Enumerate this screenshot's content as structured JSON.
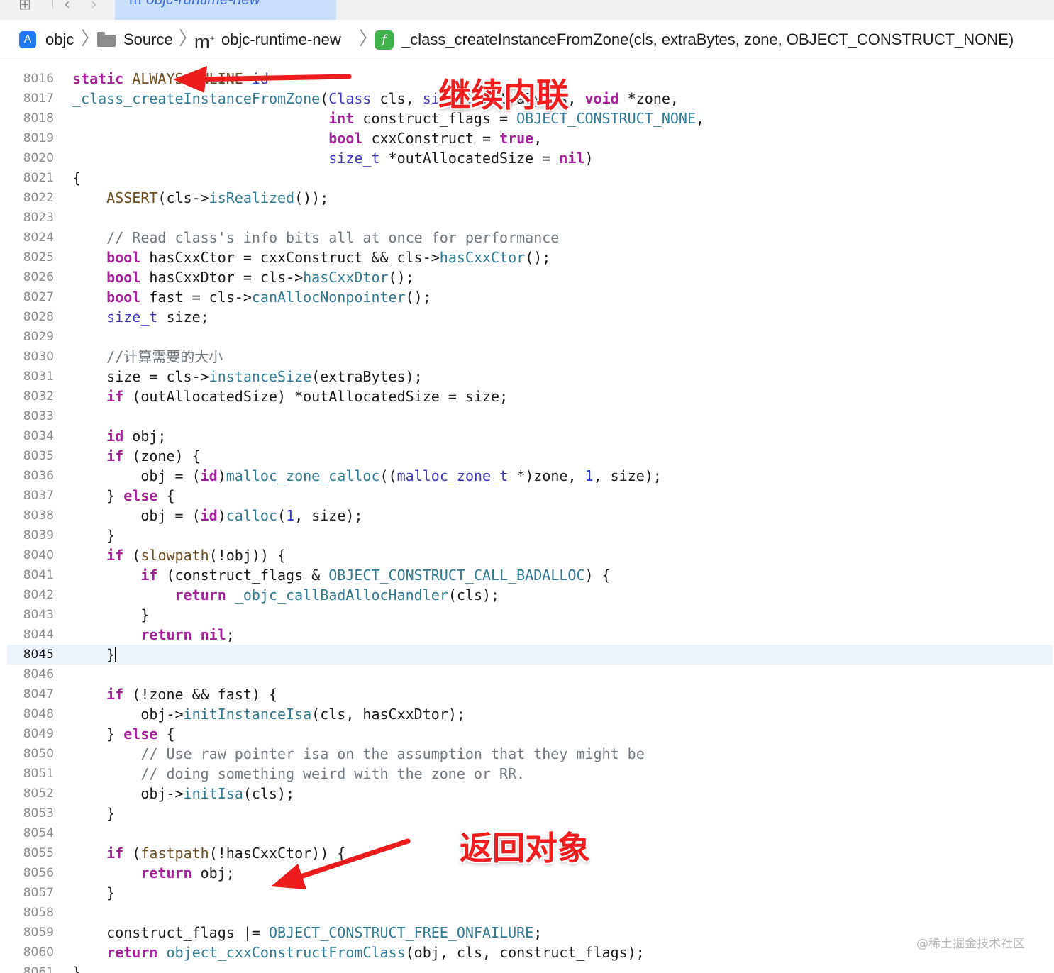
{
  "tab": {
    "label": "objc-runtime-new",
    "icon": "m"
  },
  "breadcrumb": {
    "items": [
      {
        "label": "objc"
      },
      {
        "label": "Source"
      },
      {
        "label": "objc-runtime-new"
      },
      {
        "label": "_class_createInstanceFromZone(cls, extraBytes, zone, OBJECT_CONSTRUCT_NONE)"
      }
    ]
  },
  "editor": {
    "current_line": "8045",
    "lines": [
      {
        "n": "8016",
        "html": "<span class=\"kw\">static</span> <span class=\"mc\">ALWAYS_INLINE</span> <span class=\"ty\">id</span>"
      },
      {
        "n": "8017",
        "html": "<span class=\"fn\">_class_createInstanceFromZone</span>(<span class=\"ty\">Class</span> cls, <span class=\"ty\">size_t</span> extraBytes, <span class=\"kw\">void</span> *zone,"
      },
      {
        "n": "8018",
        "html": "                              <span class=\"kw\">int</span> construct_flags = <span class=\"fn\">OBJECT_CONSTRUCT_NONE</span>,"
      },
      {
        "n": "8019",
        "html": "                              <span class=\"kw\">bool</span> cxxConstruct = <span class=\"kw\">true</span>,"
      },
      {
        "n": "8020",
        "html": "                              <span class=\"ty\">size_t</span> *outAllocatedSize = <span class=\"kw\">nil</span>)"
      },
      {
        "n": "8021",
        "html": "{"
      },
      {
        "n": "8022",
        "html": "    <span class=\"mc\">ASSERT</span>(cls-&gt;<span class=\"fn\">isRealized</span>());"
      },
      {
        "n": "8023",
        "html": ""
      },
      {
        "n": "8024",
        "html": "    <span class=\"cm\">// Read class's info bits all at once for performance</span>"
      },
      {
        "n": "8025",
        "html": "    <span class=\"kw\">bool</span> hasCxxCtor = cxxConstruct &amp;&amp; cls-&gt;<span class=\"fn\">hasCxxCtor</span>();"
      },
      {
        "n": "8026",
        "html": "    <span class=\"kw\">bool</span> hasCxxDtor = cls-&gt;<span class=\"fn\">hasCxxDtor</span>();"
      },
      {
        "n": "8027",
        "html": "    <span class=\"kw\">bool</span> fast = cls-&gt;<span class=\"fn\">canAllocNonpointer</span>();"
      },
      {
        "n": "8028",
        "html": "    <span class=\"ty\">size_t</span> size;"
      },
      {
        "n": "8029",
        "html": ""
      },
      {
        "n": "8030",
        "html": "    <span class=\"cm\">//计算需要的大小</span>"
      },
      {
        "n": "8031",
        "html": "    size = cls-&gt;<span class=\"fn\">instanceSize</span>(extraBytes);"
      },
      {
        "n": "8032",
        "html": "    <span class=\"kw\">if</span> (outAllocatedSize) *outAllocatedSize = size;"
      },
      {
        "n": "8033",
        "html": ""
      },
      {
        "n": "8034",
        "html": "    <span class=\"kw\">id</span> obj;"
      },
      {
        "n": "8035",
        "html": "    <span class=\"kw\">if</span> (zone) {"
      },
      {
        "n": "8036",
        "html": "        obj = (<span class=\"kw\">id</span>)<span class=\"fn\">malloc_zone_calloc</span>((<span class=\"ty\">malloc_zone_t</span> *)zone, <span class=\"nm\">1</span>, size);"
      },
      {
        "n": "8037",
        "html": "    } <span class=\"kw\">else</span> {"
      },
      {
        "n": "8038",
        "html": "        obj = (<span class=\"kw\">id</span>)<span class=\"fn\">calloc</span>(<span class=\"nm\">1</span>, size);"
      },
      {
        "n": "8039",
        "html": "    }"
      },
      {
        "n": "8040",
        "html": "    <span class=\"kw\">if</span> (<span class=\"mc\">slowpath</span>(!obj)) {"
      },
      {
        "n": "8041",
        "html": "        <span class=\"kw\">if</span> (construct_flags &amp; <span class=\"fn\">OBJECT_CONSTRUCT_CALL_BADALLOC</span>) {"
      },
      {
        "n": "8042",
        "html": "            <span class=\"kw\">return</span> <span class=\"fn\">_objc_callBadAllocHandler</span>(cls);"
      },
      {
        "n": "8043",
        "html": "        }"
      },
      {
        "n": "8044",
        "html": "        <span class=\"kw\">return</span> <span class=\"kw\">nil</span>;"
      },
      {
        "n": "8045",
        "html": "    }<span class=\"caret\"></span>"
      },
      {
        "n": "8046",
        "html": ""
      },
      {
        "n": "8047",
        "html": "    <span class=\"kw\">if</span> (!zone &amp;&amp; fast) {"
      },
      {
        "n": "8048",
        "html": "        obj-&gt;<span class=\"fn\">initInstanceIsa</span>(cls, hasCxxDtor);"
      },
      {
        "n": "8049",
        "html": "    } <span class=\"kw\">else</span> {"
      },
      {
        "n": "8050",
        "html": "        <span class=\"cm\">// Use raw pointer isa on the assumption that they might be</span>"
      },
      {
        "n": "8051",
        "html": "        <span class=\"cm\">// doing something weird with the zone or RR.</span>"
      },
      {
        "n": "8052",
        "html": "        obj-&gt;<span class=\"fn\">initIsa</span>(cls);"
      },
      {
        "n": "8053",
        "html": "    }"
      },
      {
        "n": "8054",
        "html": ""
      },
      {
        "n": "8055",
        "html": "    <span class=\"kw\">if</span> (<span class=\"mc\">fastpath</span>(!hasCxxCtor)) {"
      },
      {
        "n": "8056",
        "html": "        <span class=\"kw\">return</span> obj;"
      },
      {
        "n": "8057",
        "html": "    }"
      },
      {
        "n": "8058",
        "html": ""
      },
      {
        "n": "8059",
        "html": "    construct_flags |= <span class=\"fn\">OBJECT_CONSTRUCT_FREE_ONFAILURE</span>;"
      },
      {
        "n": "8060",
        "html": "    <span class=\"kw\">return</span> <span class=\"fn\">object_cxxConstructFromClass</span>(obj, cls, construct_flags);"
      },
      {
        "n": "8061",
        "html": "}"
      }
    ]
  },
  "annotations": {
    "inline_label": "继续内联",
    "return_label": "返回对象"
  },
  "watermark": "@稀土掘金技术社区",
  "colors": {
    "arrow": "#ea1c1c",
    "current_line_bg": "#edf4fc",
    "tab_bg": "#c9def9"
  }
}
